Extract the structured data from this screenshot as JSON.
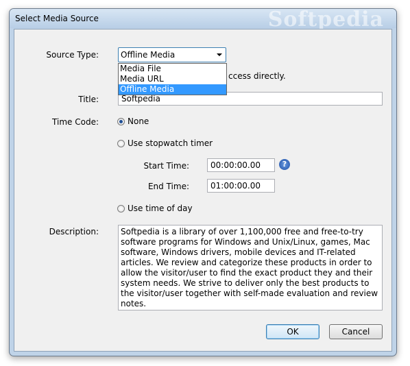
{
  "window": {
    "title": "Select Media Source",
    "watermark": "Softpedia"
  },
  "source_type": {
    "label": "Source Type:",
    "selected": "Offline Media",
    "options": [
      "Media File",
      "Media URL",
      "Offline Media"
    ],
    "highlighted_option": "Offline Media"
  },
  "hidden_hint_tail": "ccess directly.",
  "title_field": {
    "label": "Title:",
    "value": "Softpedia"
  },
  "time_code": {
    "label": "Time Code:",
    "none_label": "None",
    "stopwatch_label": "Use stopwatch timer",
    "time_of_day_label": "Use time of day",
    "selected": "None"
  },
  "start_time": {
    "label": "Start Time:",
    "value": "00:00:00.00"
  },
  "end_time": {
    "label": "End Time:",
    "value": "01:00:00.00"
  },
  "help_icon": "?",
  "description": {
    "label": "Description:",
    "value": "Softpedia is a library of over 1,100,000 free and free-to-try software programs for Windows and Unix/Linux, games, Mac software, Windows drivers, mobile devices and IT-related articles. We review and categorize these products in order to allow the visitor/user to find the exact product they and their system needs. We strive to deliver only the best products to the visitor/user together with self-made evaluation and review notes."
  },
  "buttons": {
    "ok": "OK",
    "cancel": "Cancel"
  },
  "colors": {
    "highlight": "#3399ff",
    "radio_dot": "#1f4f95",
    "help_icon": "#1d4fa6"
  }
}
